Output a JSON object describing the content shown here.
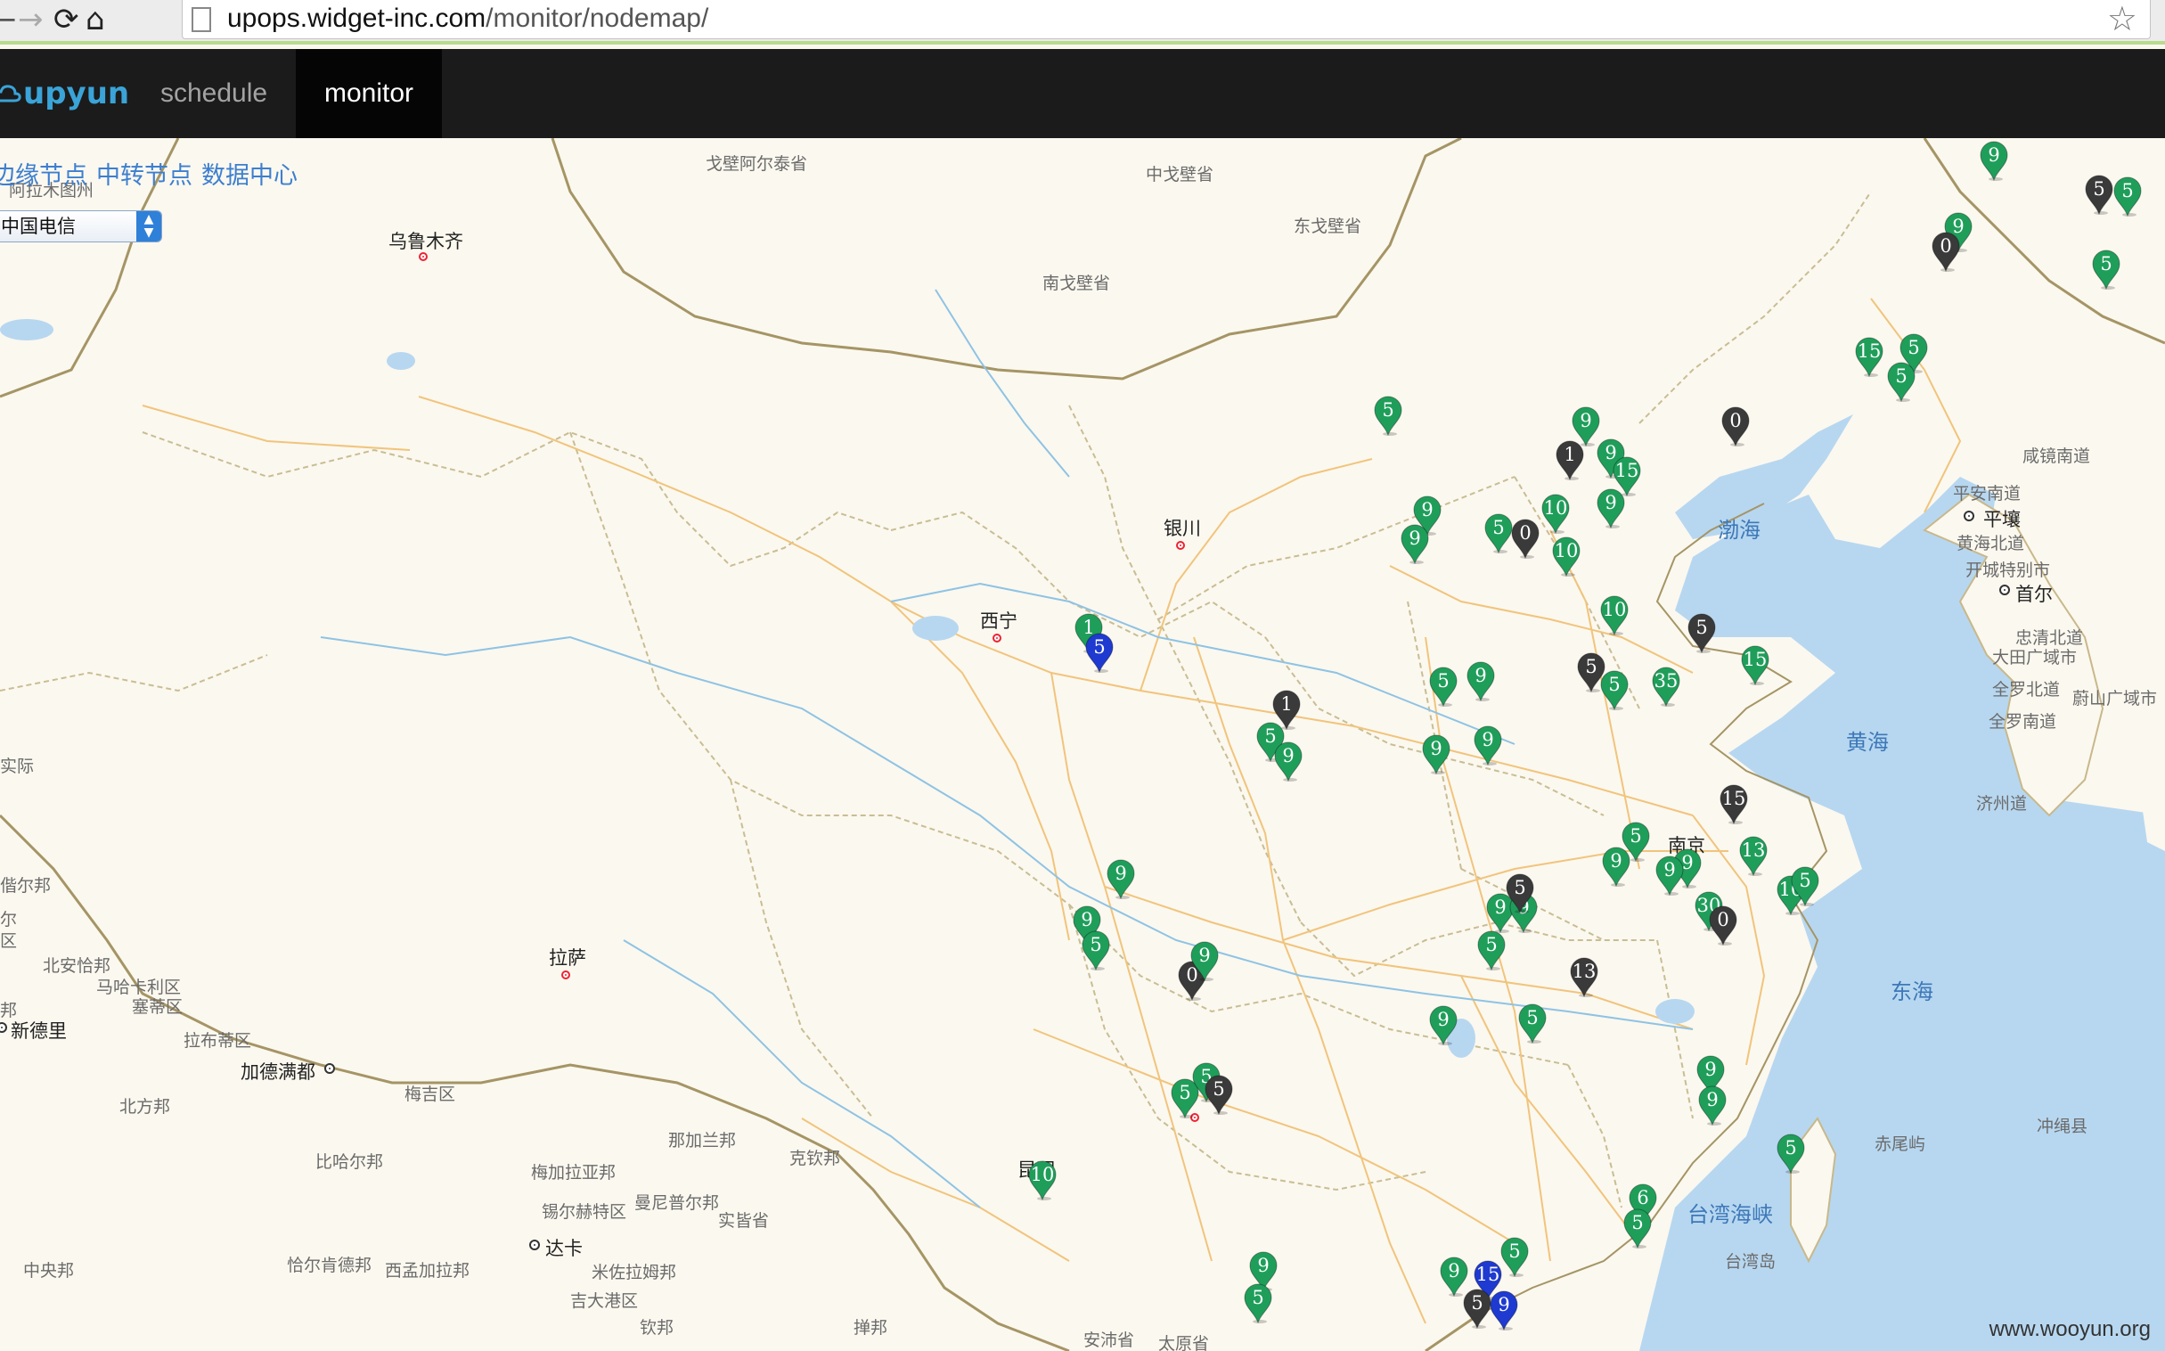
{
  "browser": {
    "url_host": "upops.widget-inc.com",
    "url_path": "/monitor/nodemap/"
  },
  "app": {
    "logo_text": "upyun",
    "nav": [
      {
        "label": "schedule",
        "active": false
      },
      {
        "label": "monitor",
        "active": true
      }
    ]
  },
  "map": {
    "legend": [
      "边缘节点",
      "中转节点",
      "数据中心"
    ],
    "isp_select": {
      "value": "中国电信"
    },
    "watermark": "www.wooyun.org",
    "labels": {
      "cities": [
        {
          "text": "乌鲁木齐",
          "key": "urumqi"
        },
        {
          "text": "西宁",
          "key": "xining"
        },
        {
          "text": "银川",
          "key": "yinchuan"
        },
        {
          "text": "拉萨",
          "key": "lhasa"
        },
        {
          "text": "南京",
          "key": "nanjing"
        },
        {
          "text": "昆明",
          "key": "kunming"
        },
        {
          "text": "首尔",
          "key": "seoul"
        },
        {
          "text": "平壤",
          "key": "pyongyang"
        },
        {
          "text": "新德里",
          "key": "newdelhi"
        },
        {
          "text": "加德满都",
          "key": "kathmandu"
        },
        {
          "text": "达卡",
          "key": "dhaka"
        }
      ],
      "seas": [
        "渤海",
        "黄海",
        "东海",
        "台湾海峡"
      ],
      "regions": [
        "戈壁阿尔泰省",
        "中戈壁省",
        "东戈壁省",
        "南戈壁省",
        "咸镜南道",
        "平安南道",
        "黄海北道",
        "开城特别市",
        "忠清北道",
        "大田广域市",
        "全罗北道",
        "蔚山广域市",
        "全罗南道",
        "济州道",
        "冲绳县",
        "赤尾屿",
        "台湾岛",
        "北安恰邦",
        "马哈卡利区",
        "塞蒂区",
        "拉布蒂区",
        "北方邦",
        "梅吉区",
        "比哈尔邦",
        "那加兰邦",
        "克钦邦",
        "梅加拉亚邦",
        "锡尔赫特区",
        "曼尼普尔邦",
        "实皆省",
        "中央邦",
        "恰尔肯德邦",
        "西孟加拉邦",
        "米佐拉姆邦",
        "吉大港区",
        "钦邦",
        "掸邦",
        "安沛省",
        "太原省",
        "阿拉木图州",
        "实际",
        "偕尔邦",
        "尔",
        "区",
        "邦"
      ]
    },
    "nodes": [
      {
        "value": "9",
        "status": "green"
      },
      {
        "value": "5",
        "status": "green"
      },
      {
        "value": "5",
        "status": "dark"
      },
      {
        "value": "9",
        "status": "green"
      },
      {
        "value": "0",
        "status": "dark"
      },
      {
        "value": "5",
        "status": "green"
      },
      {
        "value": "15",
        "status": "green"
      },
      {
        "value": "5",
        "status": "green"
      },
      {
        "value": "5",
        "status": "green"
      },
      {
        "value": "5",
        "status": "green"
      },
      {
        "value": "9",
        "status": "green"
      },
      {
        "value": "1",
        "status": "dark"
      },
      {
        "value": "9",
        "status": "green"
      },
      {
        "value": "15",
        "status": "green"
      },
      {
        "value": "0",
        "status": "dark"
      },
      {
        "value": "9",
        "status": "green"
      },
      {
        "value": "10",
        "status": "green"
      },
      {
        "value": "9",
        "status": "green"
      },
      {
        "value": "9",
        "status": "green"
      },
      {
        "value": "5",
        "status": "green"
      },
      {
        "value": "0",
        "status": "dark"
      },
      {
        "value": "10",
        "status": "green"
      },
      {
        "value": "10",
        "status": "green"
      },
      {
        "value": "5",
        "status": "dark"
      },
      {
        "value": "15",
        "status": "green"
      },
      {
        "value": "1",
        "status": "green"
      },
      {
        "value": "5",
        "status": "blue"
      },
      {
        "value": "5",
        "status": "dark"
      },
      {
        "value": "5",
        "status": "green"
      },
      {
        "value": "35",
        "status": "green"
      },
      {
        "value": "5",
        "status": "green"
      },
      {
        "value": "9",
        "status": "green"
      },
      {
        "value": "1",
        "status": "dark"
      },
      {
        "value": "5",
        "status": "green"
      },
      {
        "value": "9",
        "status": "green"
      },
      {
        "value": "9",
        "status": "green"
      },
      {
        "value": "9",
        "status": "green"
      },
      {
        "value": "15",
        "status": "dark"
      },
      {
        "value": "9",
        "status": "green"
      },
      {
        "value": "9",
        "status": "green"
      },
      {
        "value": "5",
        "status": "green"
      },
      {
        "value": "13",
        "status": "green"
      },
      {
        "value": "9",
        "status": "green"
      },
      {
        "value": "10",
        "status": "green"
      },
      {
        "value": "5",
        "status": "green"
      },
      {
        "value": "30",
        "status": "green"
      },
      {
        "value": "0",
        "status": "dark"
      },
      {
        "value": "9",
        "status": "green"
      },
      {
        "value": "9",
        "status": "green"
      },
      {
        "value": "5",
        "status": "dark"
      },
      {
        "value": "9",
        "status": "green"
      },
      {
        "value": "9",
        "status": "green"
      },
      {
        "value": "5",
        "status": "green"
      },
      {
        "value": "0",
        "status": "dark"
      },
      {
        "value": "9",
        "status": "green"
      },
      {
        "value": "5",
        "status": "green"
      },
      {
        "value": "13",
        "status": "dark"
      },
      {
        "value": "9",
        "status": "green"
      },
      {
        "value": "5",
        "status": "green"
      },
      {
        "value": "5",
        "status": "green"
      },
      {
        "value": "5",
        "status": "green"
      },
      {
        "value": "5",
        "status": "dark"
      },
      {
        "value": "9",
        "status": "green"
      },
      {
        "value": "9",
        "status": "green"
      },
      {
        "value": "5",
        "status": "green"
      },
      {
        "value": "6",
        "status": "green"
      },
      {
        "value": "5",
        "status": "green"
      },
      {
        "value": "5",
        "status": "green"
      },
      {
        "value": "9",
        "status": "green"
      },
      {
        "value": "5",
        "status": "green"
      },
      {
        "value": "10",
        "status": "green"
      },
      {
        "value": "9",
        "status": "green"
      },
      {
        "value": "15",
        "status": "blue"
      },
      {
        "value": "5",
        "status": "dark"
      },
      {
        "value": "9",
        "status": "blue"
      }
    ],
    "colors": {
      "green": "#1f9e5a",
      "dark": "#3a3a3a",
      "blue": "#1e3ad0"
    }
  }
}
